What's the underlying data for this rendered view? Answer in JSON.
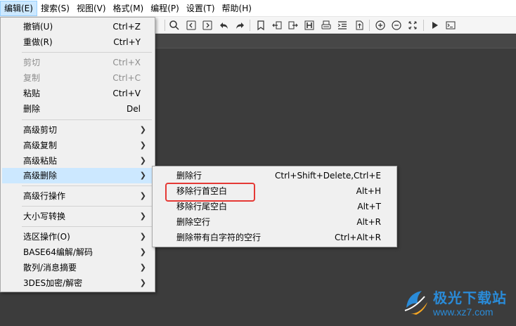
{
  "menubar": {
    "items": [
      "编辑(E)",
      "搜索(S)",
      "视图(V)",
      "格式(M)",
      "编程(P)",
      "设置(T)",
      "帮助(H)"
    ]
  },
  "toolbar": {
    "icons": [
      "search-icon",
      "prev-icon",
      "next-icon",
      "undo-icon",
      "redo-icon",
      "bookmark-icon",
      "move-left-icon",
      "move-right-icon",
      "header-icon",
      "print-icon",
      "indent-icon",
      "file-icon",
      "zoom-in-icon",
      "zoom-out-icon",
      "fullscreen-icon",
      "run-icon",
      "terminal-icon"
    ]
  },
  "edit_menu": {
    "items": [
      {
        "label": "撤销(U)",
        "shortcut": "Ctrl+Z"
      },
      {
        "label": "重做(R)",
        "shortcut": "Ctrl+Y"
      },
      {
        "label": "剪切",
        "shortcut": "Ctrl+X",
        "disabled": true
      },
      {
        "label": "复制",
        "shortcut": "Ctrl+C",
        "disabled": true
      },
      {
        "label": "粘贴",
        "shortcut": "Ctrl+V"
      },
      {
        "label": "删除",
        "shortcut": "Del"
      },
      {
        "label": "高级剪切",
        "submenu": true
      },
      {
        "label": "高级复制",
        "submenu": true
      },
      {
        "label": "高级粘贴",
        "submenu": true
      },
      {
        "label": "高级删除",
        "submenu": true,
        "active": true
      },
      {
        "label": "高级行操作",
        "submenu": true
      },
      {
        "label": "大小写转换",
        "submenu": true
      },
      {
        "label": "选区操作(O)",
        "submenu": true
      },
      {
        "label": "BASE64编解/解码",
        "submenu": true
      },
      {
        "label": "散列/消息摘要",
        "submenu": true
      },
      {
        "label": "3DES加密/解密",
        "submenu": true
      }
    ]
  },
  "advanced_delete_submenu": {
    "items": [
      {
        "label": "删除行",
        "shortcut": "Ctrl+Shift+Delete,Ctrl+E"
      },
      {
        "label": "移除行首空白",
        "shortcut": "Alt+H",
        "highlighted": true
      },
      {
        "label": "移除行尾空白",
        "shortcut": "Alt+T"
      },
      {
        "label": "删除空行",
        "shortcut": "Alt+R"
      },
      {
        "label": "删除带有白字符的空行",
        "shortcut": "Ctrl+Alt+R"
      }
    ]
  },
  "watermark": {
    "title": "极光下载站",
    "url": "www.xz7.com"
  },
  "colors": {
    "menu_highlight": "#cce8ff",
    "annotation_red": "#e53935",
    "editor_bg": "#3c3c3c",
    "watermark_blue": "#2a8bd8"
  }
}
